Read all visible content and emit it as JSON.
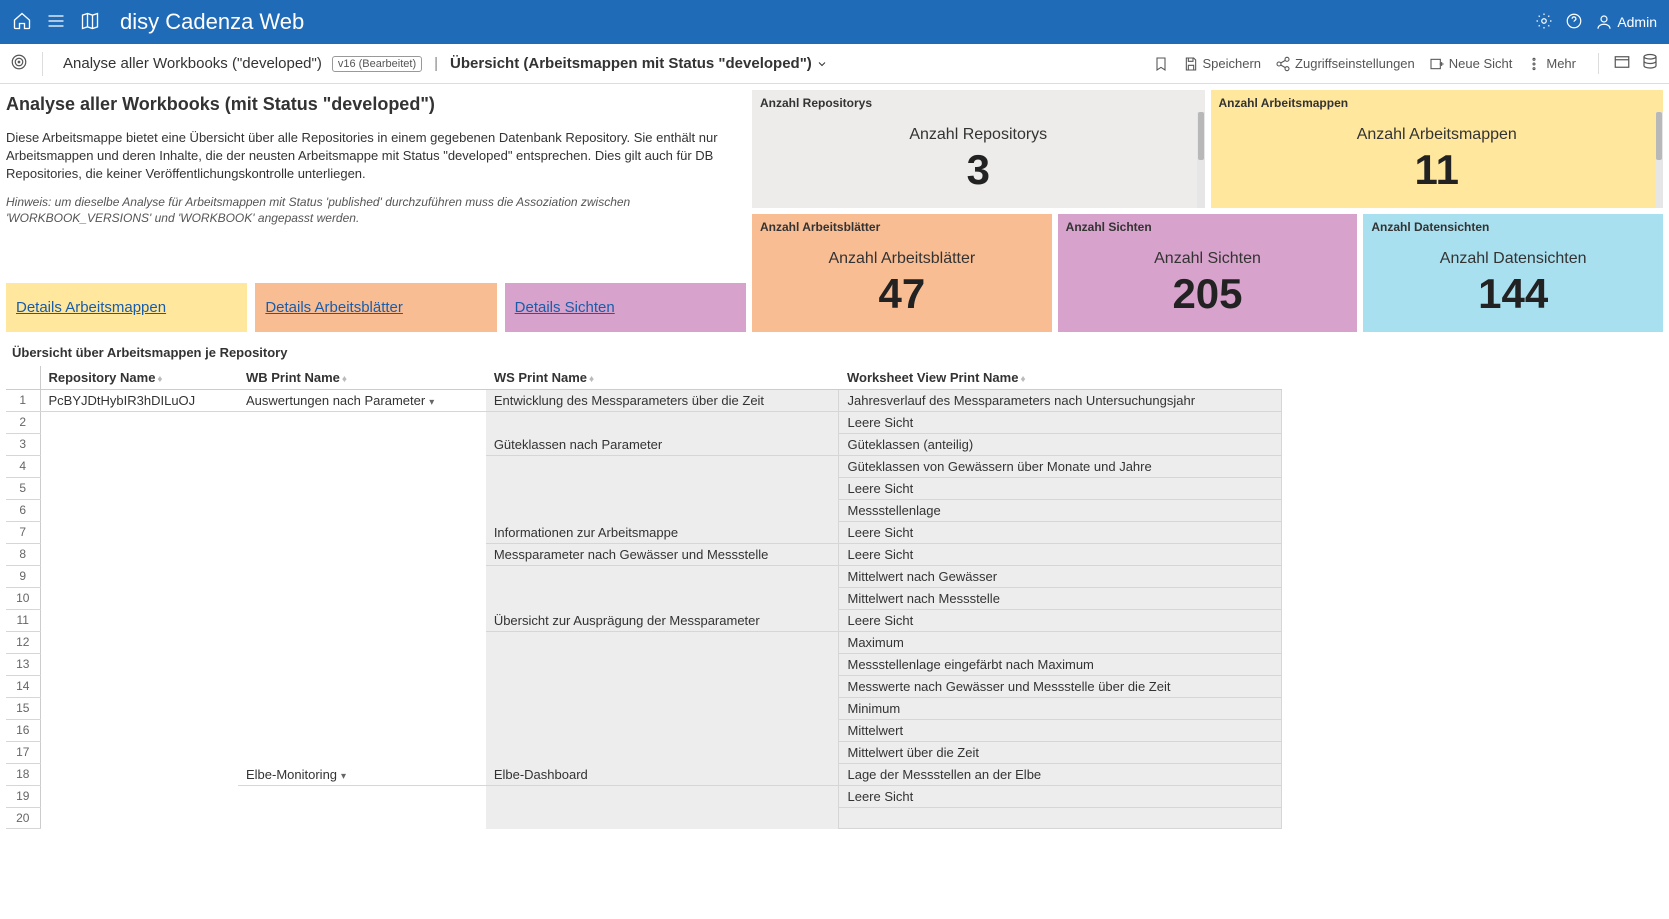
{
  "app": {
    "title": "disy Cadenza Web",
    "user": "Admin"
  },
  "breadcrumb": {
    "workbook": "Analyse aller Workbooks (\"developed\")",
    "version": "v16 (Bearbeitet)",
    "sheet": "Übersicht (Arbeitsmappen mit Status \"developed\")"
  },
  "actions": {
    "save": "Speichern",
    "access": "Zugriffseinstellungen",
    "newView": "Neue Sicht",
    "more": "Mehr"
  },
  "intro": {
    "title": "Analyse aller Workbooks (mit Status \"developed\")",
    "p1": "Diese Arbeitsmappe bietet eine Übersicht über alle Repositories in einem gegebenen Datenbank Repository. Sie enthält nur Arbeitsmappen und deren Inhalte, die der neusten Arbeitsmappe mit Status \"developed\" entsprechen. Dies gilt auch für DB Repositories, die keiner Veröffentlichungskontrolle unterliegen.",
    "hint": "Hinweis: um dieselbe Analyse für Arbeitsmappen mit Status 'published' durchzuführen muss die Assoziation zwischen 'WORKBOOK_VERSIONS' und 'WORKBOOK' angepasst werden.",
    "link1": "Details Arbeitsmappen",
    "link2": "Details Arbeitsblätter",
    "link3": "Details Sichten"
  },
  "tiles": {
    "repos": {
      "head": "Anzahl Repositorys",
      "label": "Anzahl Repositorys",
      "value": "3"
    },
    "workbooks": {
      "head": "Anzahl Arbeitsmappen",
      "label": "Anzahl Arbeitsmappen",
      "value": "11"
    },
    "sheets": {
      "head": "Anzahl Arbeitsblätter",
      "label": "Anzahl Arbeitsblätter",
      "value": "47"
    },
    "views": {
      "head": "Anzahl Sichten",
      "label": "Anzahl Sichten",
      "value": "205"
    },
    "dataviews": {
      "head": "Anzahl Datensichten",
      "label": "Anzahl Datensichten",
      "value": "144"
    }
  },
  "table": {
    "title": "Übersicht über Arbeitsmappen je Repository",
    "cols": {
      "repo": "Repository Name",
      "wb": "WB Print Name",
      "ws": "WS Print Name",
      "view": "Worksheet View Print Name"
    },
    "rows": [
      {
        "n": "1",
        "repo": "PcBYJDtHybIR3hDILuOJ",
        "wb": "Auswertungen nach Parameter",
        "wbCaret": true,
        "ws": "Entwicklung des Messparameters über die Zeit",
        "view": "Jahresverlauf des Messparameters nach Untersuchungsjahr"
      },
      {
        "n": "2",
        "repo": "",
        "wb": "",
        "ws": "",
        "view": "Leere Sicht"
      },
      {
        "n": "3",
        "repo": "",
        "wb": "",
        "ws": "Güteklassen nach Parameter",
        "view": "Güteklassen (anteilig)"
      },
      {
        "n": "4",
        "repo": "",
        "wb": "",
        "ws": "",
        "view": "Güteklassen von Gewässern über Monate und Jahre"
      },
      {
        "n": "5",
        "repo": "",
        "wb": "",
        "ws": "",
        "view": "Leere Sicht"
      },
      {
        "n": "6",
        "repo": "",
        "wb": "",
        "ws": "",
        "view": "Messstellenlage"
      },
      {
        "n": "7",
        "repo": "",
        "wb": "",
        "ws": "Informationen zur Arbeitsmappe",
        "view": "Leere Sicht"
      },
      {
        "n": "8",
        "repo": "",
        "wb": "",
        "ws": "Messparameter nach Gewässer und Messstelle",
        "view": "Leere Sicht"
      },
      {
        "n": "9",
        "repo": "",
        "wb": "",
        "ws": "",
        "view": "Mittelwert nach Gewässer"
      },
      {
        "n": "10",
        "repo": "",
        "wb": "",
        "ws": "",
        "view": "Mittelwert nach Messstelle"
      },
      {
        "n": "11",
        "repo": "",
        "wb": "",
        "ws": "Übersicht zur Ausprägung der Messparameter",
        "view": "Leere Sicht"
      },
      {
        "n": "12",
        "repo": "",
        "wb": "",
        "ws": "",
        "view": "Maximum"
      },
      {
        "n": "13",
        "repo": "",
        "wb": "",
        "ws": "",
        "view": "Messstellenlage eingefärbt nach Maximum"
      },
      {
        "n": "14",
        "repo": "",
        "wb": "",
        "ws": "",
        "view": "Messwerte nach Gewässer und Messstelle über die Zeit"
      },
      {
        "n": "15",
        "repo": "",
        "wb": "",
        "ws": "",
        "view": "Minimum"
      },
      {
        "n": "16",
        "repo": "",
        "wb": "",
        "ws": "",
        "view": "Mittelwert"
      },
      {
        "n": "17",
        "repo": "",
        "wb": "",
        "ws": "",
        "view": "Mittelwert über die Zeit"
      },
      {
        "n": "18",
        "repo": "",
        "wb": "Elbe-Monitoring",
        "wbCaret": true,
        "ws": "Elbe-Dashboard",
        "view": "Lage der Messstellen an der Elbe"
      },
      {
        "n": "19",
        "repo": "",
        "wb": "",
        "ws": "",
        "view": "Leere Sicht"
      },
      {
        "n": "20",
        "repo": "",
        "wb": "",
        "ws": "",
        "view": ""
      }
    ]
  }
}
